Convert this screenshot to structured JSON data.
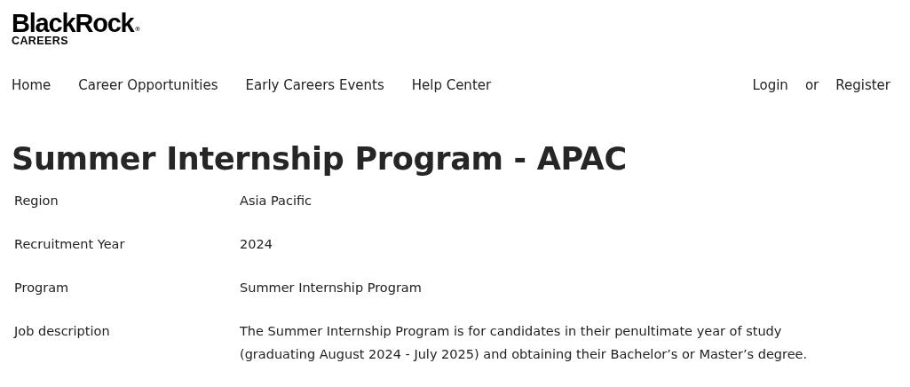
{
  "logo": {
    "wordmark": "BlackRock",
    "registered": "®",
    "subtitle": "CAREERS"
  },
  "nav": {
    "items": [
      {
        "label": "Home"
      },
      {
        "label": "Career Opportunities"
      },
      {
        "label": "Early Careers Events"
      },
      {
        "label": "Help Center"
      }
    ],
    "account": {
      "login": "Login",
      "separator": "or",
      "register": "Register"
    }
  },
  "title": "Summer Internship Program - APAC",
  "details": [
    {
      "label": "Region",
      "value": "Asia Pacific"
    },
    {
      "label": "Recruitment Year",
      "value": "2024"
    },
    {
      "label": "Program",
      "value": "Summer Internship Program"
    },
    {
      "label": "Job description",
      "value": "The Summer Internship Program is for candidates in their penultimate year of study (graduating August 2024 - July 2025) and obtaining their Bachelor’s or Master’s degree."
    }
  ]
}
